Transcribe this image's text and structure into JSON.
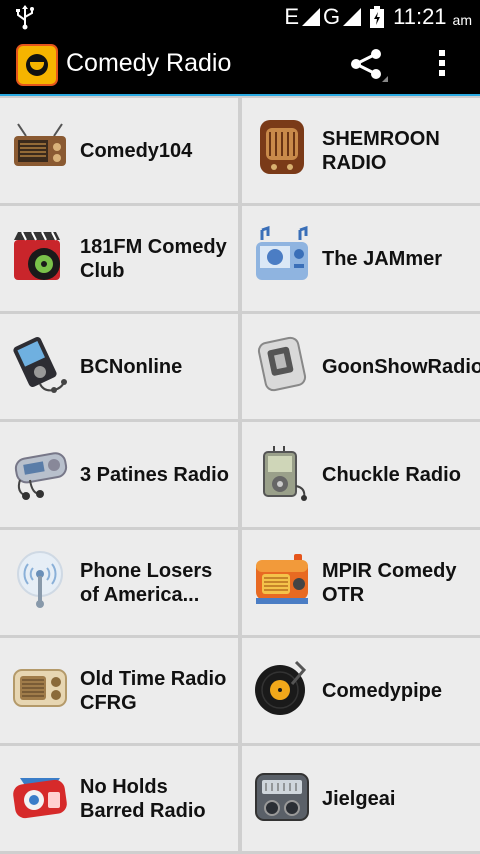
{
  "status_bar": {
    "network": "E",
    "network2": "G",
    "time": "11:21",
    "ampm": "am"
  },
  "action_bar": {
    "title": "Comedy Radio"
  },
  "stations": [
    {
      "name": "Comedy104",
      "icon": "vintage-radio-icon"
    },
    {
      "name": "SHEMROON RADIO",
      "icon": "wooden-radio-icon"
    },
    {
      "name": "181FM Comedy Club",
      "icon": "media-player-icon"
    },
    {
      "name": "The JAMmer",
      "icon": "music-player-icon"
    },
    {
      "name": "BCNonline",
      "icon": "mp3-player-icon"
    },
    {
      "name": "GoonShowRadio",
      "icon": "portable-player-icon"
    },
    {
      "name": "3 Patines Radio",
      "icon": "walkman-icon"
    },
    {
      "name": "Chuckle Radio",
      "icon": "ipod-icon"
    },
    {
      "name": "Phone Losers of America...",
      "icon": "antenna-icon"
    },
    {
      "name": "MPIR Comedy OTR",
      "icon": "retro-radio-icon"
    },
    {
      "name": "Old Time Radio CFRG",
      "icon": "cream-radio-icon"
    },
    {
      "name": "Comedypipe",
      "icon": "vinyl-record-icon"
    },
    {
      "name": "No Holds Barred Radio",
      "icon": "red-radio-icon"
    },
    {
      "name": "Jielgeai",
      "icon": "gray-radio-icon"
    }
  ]
}
